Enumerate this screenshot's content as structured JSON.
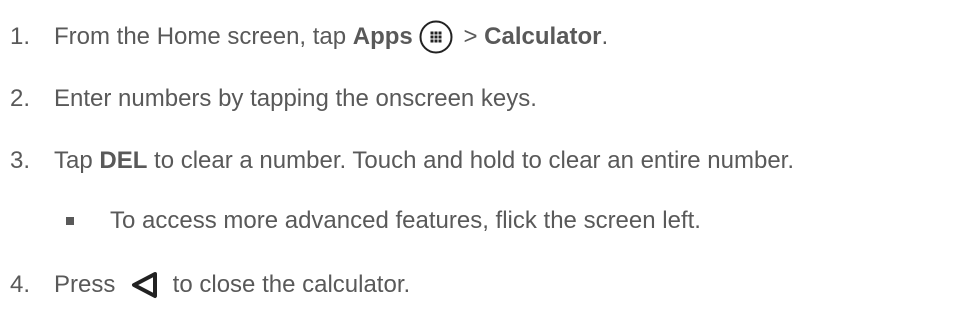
{
  "steps": [
    {
      "number": "1.",
      "prefix": "From the Home screen, tap ",
      "bold1": "Apps",
      "icon": "apps-grid-icon",
      "separator": " > ",
      "bold2": "Calculator",
      "suffix": "."
    },
    {
      "number": "2.",
      "text": "Enter numbers by tapping the onscreen keys."
    },
    {
      "number": "3.",
      "prefix": "Tap ",
      "bold": "DEL",
      "suffix": " to clear a number. Touch and hold to clear an entire number."
    },
    {
      "number": "4.",
      "prefix": "Press ",
      "icon": "back-triangle-icon",
      "suffix": " to close the calculator."
    }
  ],
  "bullet": {
    "text": "To access more advanced features, flick the screen left."
  },
  "colors": {
    "text": "#595959"
  }
}
